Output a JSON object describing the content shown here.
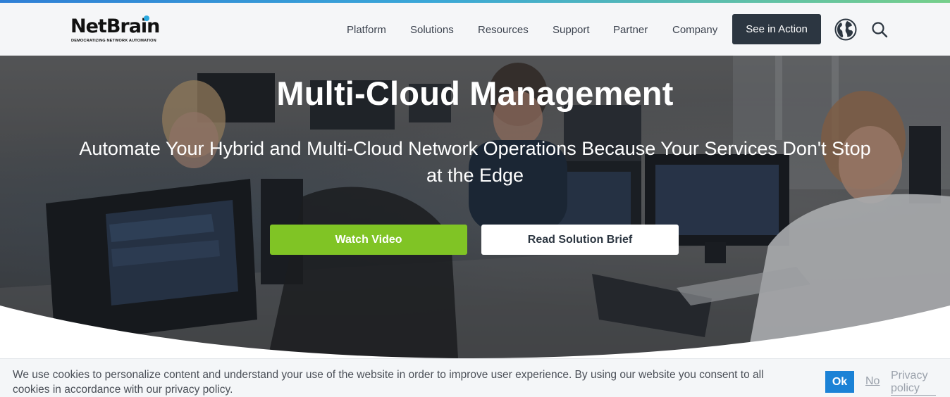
{
  "brand": {
    "logo_text": "NetBrain",
    "tagline": "DEMOCRATIZING NETWORK AUTOMATION",
    "accent_color": "#80c425",
    "dark_color": "#2c3641",
    "link_color": "#1b82d6"
  },
  "nav": {
    "items": [
      {
        "label": "Platform"
      },
      {
        "label": "Solutions"
      },
      {
        "label": "Resources"
      },
      {
        "label": "Support"
      },
      {
        "label": "Partner"
      },
      {
        "label": "Company"
      }
    ],
    "cta_label": "See in Action",
    "icons": [
      "globe-icon",
      "search-icon"
    ]
  },
  "hero": {
    "title": "Multi-Cloud Management",
    "subtitle": "Automate Your Hybrid and Multi-Cloud Network Operations Because Your Services Don't Stop at the Edge",
    "primary_button": "Watch Video",
    "secondary_button": "Read Solution Brief"
  },
  "cookie_banner": {
    "text": "We use cookies to personalize content and understand your use of the website in order to improve user experience. By using our website you consent to all cookies in accordance with our privacy policy.",
    "ok_label": "Ok",
    "no_label": "No",
    "privacy_label": "Privacy policy"
  }
}
